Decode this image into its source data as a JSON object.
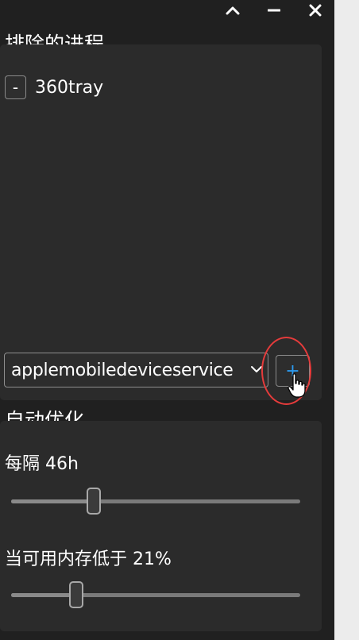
{
  "window": {
    "controls": [
      "chevron-up-icon",
      "minimize-icon",
      "close-icon"
    ]
  },
  "excluded": {
    "title": "排除的进程",
    "items": [
      {
        "remove_label": "-",
        "name": "360tray"
      }
    ],
    "select_value": "applemobiledeviceservice",
    "add_label": "+"
  },
  "auto_optimize": {
    "title": "自动优化",
    "interval": {
      "label": "每隔 46h",
      "value": 46,
      "fraction": 0.275
    },
    "memory": {
      "label": "当可用内存低于 21%",
      "value": 21,
      "fraction": 0.21
    }
  },
  "colors": {
    "accent": "#2b9bf0",
    "highlight": "#e53b3b",
    "panel": "#2b2b2b",
    "background": "#202020"
  }
}
